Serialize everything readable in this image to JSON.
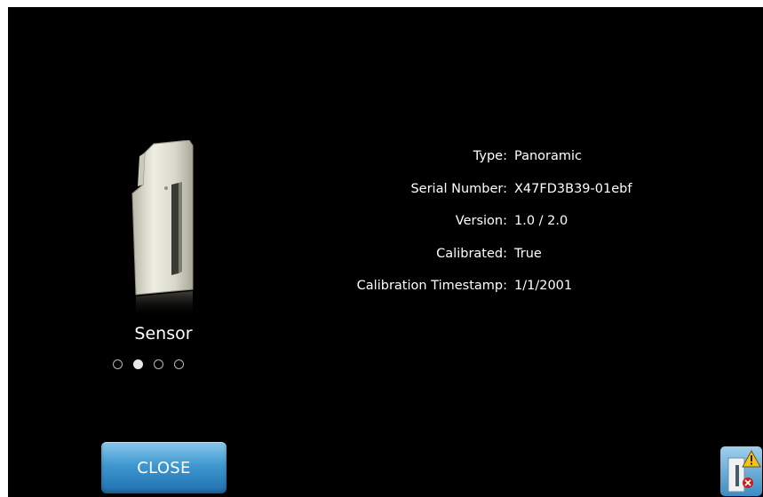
{
  "device": {
    "label": "Sensor",
    "icon": "sensor-device-icon"
  },
  "pager": {
    "count": 4,
    "active_index": 1
  },
  "details": [
    {
      "label": "Type:",
      "value": "Panoramic"
    },
    {
      "label": "Serial Number:",
      "value": "X47FD3B39-01ebf"
    },
    {
      "label": "Version:",
      "value": "1.0 / 2.0"
    },
    {
      "label": "Calibrated:",
      "value": "True"
    },
    {
      "label": "Calibration Timestamp:",
      "value": "1/1/2001"
    }
  ],
  "actions": {
    "close_label": "CLOSE"
  },
  "corner_icon": "device-warning-icon",
  "colors": {
    "background": "#000000",
    "text": "#ffffff",
    "button_top": "#8ac8ec",
    "button_bottom": "#1f6fae"
  }
}
